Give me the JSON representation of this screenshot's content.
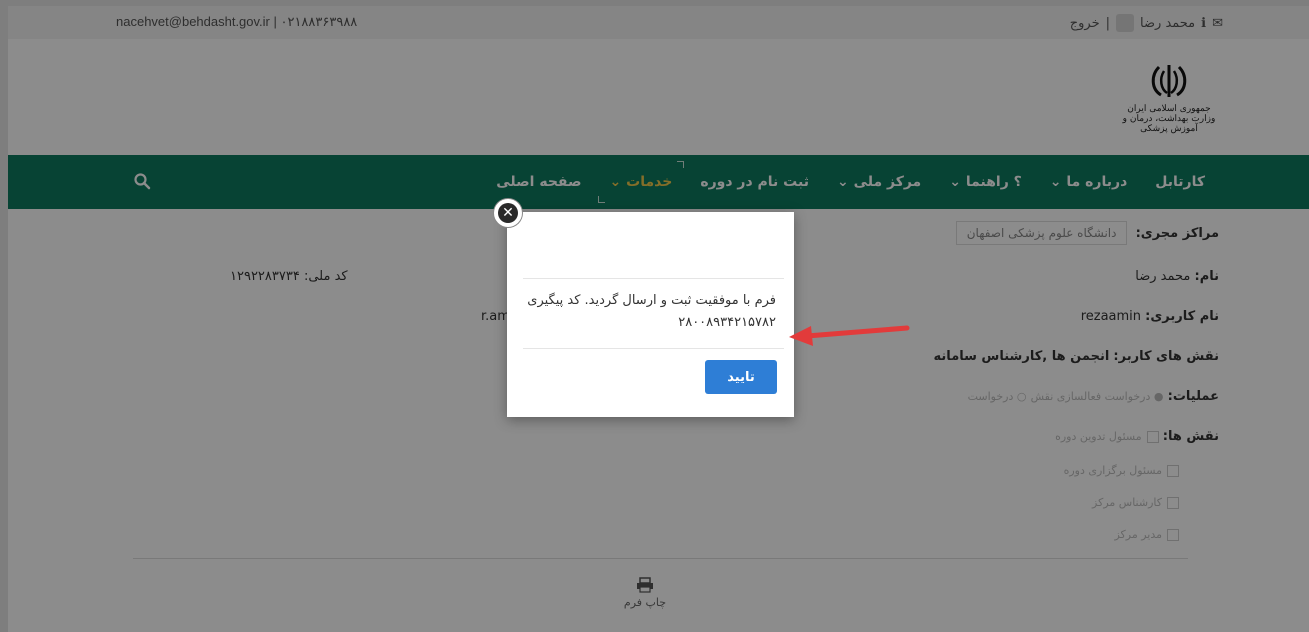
{
  "topbar": {
    "contact": "nacehvet@behdasht.gov.ir | ۰۲۱۸۸۳۶۳۹۸۸",
    "user_name": "محمد رضا",
    "logout": "خروج",
    "separator": "|"
  },
  "header": {
    "emblem_line1": "جمهوری اسلامی ایران",
    "emblem_line2": "وزارت بهداشت، درمان و آموزش پزشکی"
  },
  "nav": {
    "items": [
      {
        "label": "صفحه اصلی"
      },
      {
        "label": "خدمات ⌄"
      },
      {
        "label": "ثبت نام در دوره"
      },
      {
        "label": "مرکز ملی ⌄"
      },
      {
        "label": "؟ راهنما ⌄"
      },
      {
        "label": "درباره ما ⌄"
      },
      {
        "label": "کارتابل"
      }
    ],
    "accent": "#0d7a5f"
  },
  "form": {
    "centers_label": "مراکز مجری:",
    "centers_value": "دانشگاه علوم پزشکی اصفهان",
    "name_label": "نام:",
    "name_value": "محمد رضا",
    "national_code_label": "کد ملی:",
    "national_code_value": "۱۲۹۲۲۸۳۷۳۴",
    "username_label": "نام کاربری:",
    "username_value": "rezaamin",
    "email_partial": "r.amin",
    "roles_label": "نقش های کاربر:",
    "roles_value": "انجمن ها ,کارشناس سامانه",
    "ops_label": "عملیات:",
    "ops_option1": "درخواست فعالسازی نقش",
    "ops_option2": "درخواست",
    "role_list_label": "نقش ها:",
    "role_list": [
      "مسئول تدوین دوره",
      "مسئول برگزاری دوره",
      "کارشناس مرکز",
      "مدیر مرکز"
    ],
    "print_label": "چاپ فرم"
  },
  "modal": {
    "message": "فرم با موفقیت ثبت و ارسال گردید. کد پیگیری ۲۸۰۰۸۹۳۴۲۱۵۷۸۲",
    "ok_label": "تایید",
    "close_symbol": "✕"
  }
}
